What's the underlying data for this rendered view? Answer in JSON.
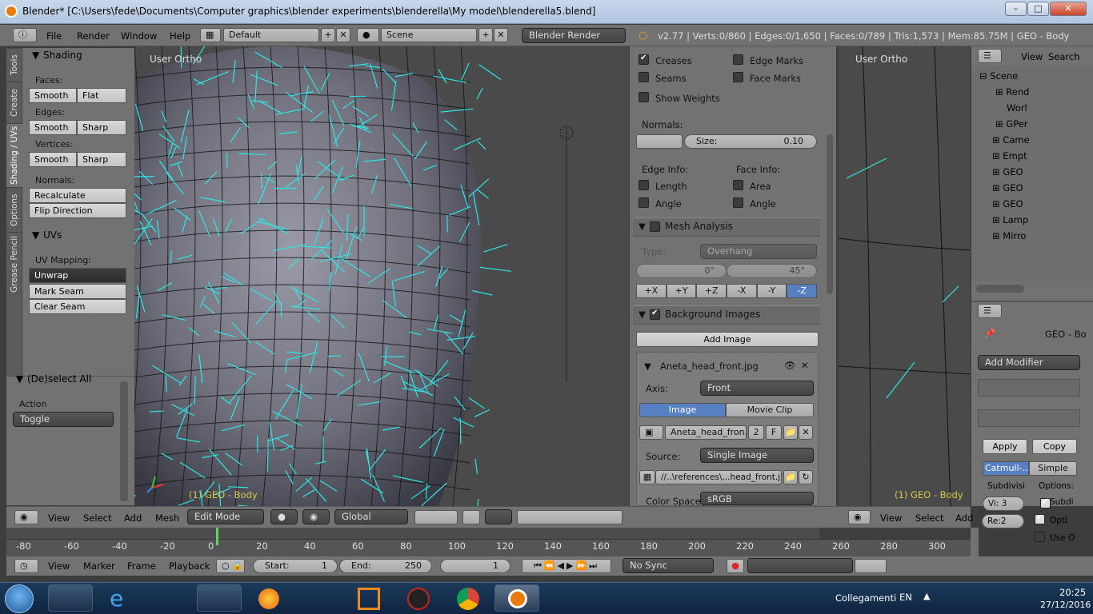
{
  "window": {
    "title": "Blender* [C:\\Users\\fede\\Documents\\Computer graphics\\blender experiments\\blenderella\\My model\\blenderella5.blend]"
  },
  "header": {
    "menus": [
      "File",
      "Render",
      "Window",
      "Help"
    ],
    "layout": "Default",
    "scene": "Scene",
    "engine": "Blender Render",
    "stats": "v2.77 | Verts:0/860 | Edges:0/1,650 | Faces:0/789 | Tris:1,573 | Mem:85.75M | GEO - Body"
  },
  "toolshelf": {
    "tabs": [
      "Tools",
      "Create",
      "Shading / UVs",
      "Options",
      "Grease Pencil"
    ],
    "shading_title": "Shading",
    "faces_label": "Faces:",
    "smooth": "Smooth",
    "flat": "Flat",
    "edges_label": "Edges:",
    "sharp": "Sharp",
    "vertices_label": "Vertices:",
    "normals_label": "Normals:",
    "recalculate": "Recalculate",
    "flip_direction": "Flip Direction",
    "uvs_title": "UVs",
    "uv_mapping_label": "UV Mapping:",
    "unwrap": "Unwrap",
    "mark_seam": "Mark Seam",
    "clear_seam": "Clear Seam",
    "operator_title": "(De)select All",
    "action_label": "Action",
    "action_value": "Toggle"
  },
  "viewport": {
    "view_name": "User Ortho",
    "object_name": "(1) GEO - Body"
  },
  "viewport2": {
    "view_name": "User Ortho",
    "object_name": "(1) GEO - Body"
  },
  "props": {
    "creases": "Creases",
    "edge_marks": "Edge Marks",
    "seams": "Seams",
    "face_marks": "Face Marks",
    "show_weights": "Show Weights",
    "normals_label": "Normals:",
    "size_label": "Size:",
    "size_value": "0.10",
    "edge_info": "Edge Info:",
    "face_info": "Face Info:",
    "length": "Length",
    "area": "Area",
    "angle": "Angle",
    "mesh_analysis": "Mesh Analysis",
    "type_label": "Type:",
    "type_value": "Overhang",
    "min_angle": "0°",
    "max_angle": "45°",
    "axes": [
      "+X",
      "+Y",
      "+Z",
      "-X",
      "-Y",
      "-Z"
    ],
    "background_images": "Background Images",
    "add_image": "Add Image",
    "image_name": "Aneta_head_front.jpg",
    "axis_label": "Axis:",
    "axis_value": "Front",
    "tab_image": "Image",
    "tab_movie_clip": "Movie Clip",
    "image_field": "Aneta_head_fron...",
    "users": "2",
    "fake": "F",
    "source_label": "Source:",
    "source_value": "Single Image",
    "filepath": "//..\\references\\...head_front.jpg",
    "color_space_label": "Color Space:",
    "color_space_value": "sRGB"
  },
  "outliner": {
    "view": "View",
    "search": "Search",
    "items": [
      "Scene",
      "Rend",
      "Worl",
      "GPer",
      "Came",
      "Empt",
      "GEO",
      "GEO",
      "GEO",
      "Lamp",
      "Mirro"
    ]
  },
  "modifiers": {
    "object_name": "GEO - Bo",
    "add_modifier": "Add Modifier",
    "apply": "Apply",
    "copy": "Copy",
    "catmull": "Catmull-...",
    "simple": "Simple",
    "subdivisions": "Subdivisi",
    "options": "Options:",
    "view_levels": "Vi: 3",
    "render_levels": "Re:2",
    "subdiv_uvs": "Subdi",
    "optimal": "Opti",
    "use_opensubdiv": "Use O"
  },
  "vpheader": {
    "menus": [
      "View",
      "Select",
      "Add",
      "Mesh"
    ],
    "mode": "Edit Mode",
    "orientation": "Global",
    "menus2": [
      "View",
      "Select",
      "Add"
    ]
  },
  "timeline": {
    "ticks": [
      "-80",
      "-60",
      "-40",
      "-20",
      "0",
      "20",
      "40",
      "60",
      "80",
      "100",
      "120",
      "140",
      "160",
      "180",
      "200",
      "220",
      "240",
      "260",
      "280",
      "300"
    ],
    "menus": [
      "View",
      "Marker",
      "Frame",
      "Playback"
    ],
    "start_label": "Start:",
    "start": "1",
    "end_label": "End:",
    "end": "250",
    "current": "1",
    "sync": "No Sync"
  },
  "taskbar": {
    "collegamenti": "Collegamenti",
    "lang": "EN",
    "time": "20:25",
    "date": "27/12/2016"
  }
}
